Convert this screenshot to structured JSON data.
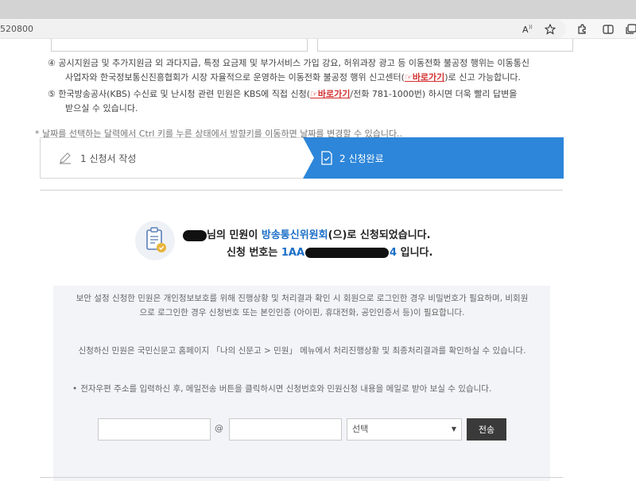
{
  "browser": {
    "url_fragment": "520800",
    "icons": [
      "read-aloud-icon",
      "favorite-star-icon",
      "extensions-icon",
      "split-screen-icon",
      "collections-icon"
    ]
  },
  "notices": {
    "item4_line1": "④ 공시지원금 및 추가지원금 외 과다지급, 특정 요금제 및 부가서비스 가입 강요, 허위과장 광고 등 이동전화 불공정 행위는 이동통신",
    "item4_line2_a": "사업자와 한국정보통신진흥협회가 시장 자율적으로 운영하는 이동전화 불공정 행위 신고센터(",
    "item4_link": "☞바로가기",
    "item4_line2_b": ")로 신고 가능합니다.",
    "item5_line1_a": "⑤ 한국방송공사(KBS) 수신료 및 난시청 관련 민원은 KBS에 직접 신청(",
    "item5_link": "☞바로가기",
    "item5_line1_b": "/전화 781-1000번) 하시면 더욱 빨리 답변을",
    "item5_line2": "받으실 수 있습니다."
  },
  "hint": "* 날짜를 선택하는 달력에서 Ctrl 키를 누른 상태에서 방향키를 이동하면 날짜를 변경할 수 있습니다..",
  "steps": {
    "step1": "1 신청서 작성",
    "step2": "2 신청완료"
  },
  "result": {
    "line1_a": "님의 민원이 ",
    "agency": "방송통신위원회",
    "line1_b": "(으)로 신청되었습니다.",
    "line2_a": "신청 번호는 ",
    "number_visible_start": "1AA",
    "number_visible_end": "4",
    "line2_b": " 입니다."
  },
  "info": {
    "p1": "보안 설정 신청한 민원은 개인정보보호를 위해 진행상황 및 처리결과 확인 시 회원으로 로그인한 경우 비밀번호가 필요하며, 비회원으로 로그인한 경우 신청번호 또는 본인인증 (아이핀, 휴대전화, 공인인증서 등)이 필요합니다.",
    "p2": "신청하신 민원은 국민신문고 홈페이지 「나의 신문고 > 민원」 메뉴에서 처리진행상황 및 최종처리결과를 확인하실 수 있습니다.",
    "p3": "전자우편 주소를 입력하신 후, 메일전송 버튼을 클릭하시면 신청번호와 민원신청 내용을 메일로 받아 보실 수 있습니다."
  },
  "email_form": {
    "at": "@",
    "domain_select": "선택",
    "send_label": "전송"
  }
}
